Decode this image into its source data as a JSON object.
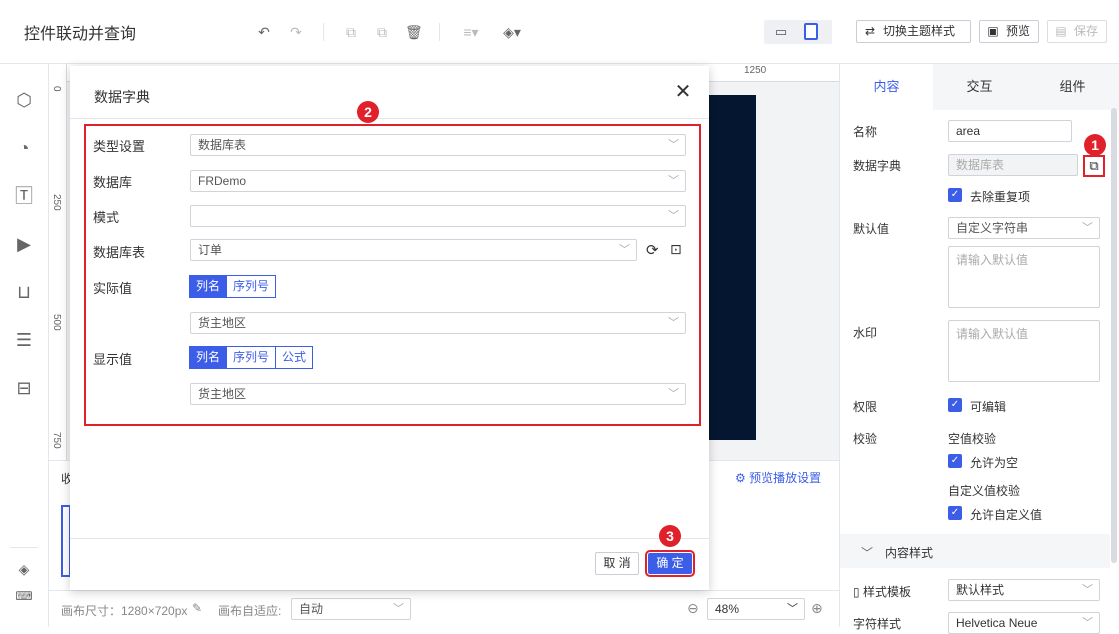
{
  "app": {
    "title": "控件联动并查询"
  },
  "toolbar": {
    "switch_theme": "切换主题样式",
    "preview": "预览",
    "save": "保存"
  },
  "ruler": {
    "top_mark": "1250",
    "left_marks": [
      "0",
      "250",
      "500",
      "750"
    ]
  },
  "canvas": {
    "collapse_label": "收",
    "preview_play_settings": "预览播放设置",
    "size_label": "画布尺寸：1280×720px",
    "adapt_label": "画布自适应:",
    "adapt_value": "自动",
    "zoom": "48%"
  },
  "dialog": {
    "title": "数据字典",
    "fields": {
      "type_label": "类型设置",
      "type_value": "数据库表",
      "db_label": "数据库",
      "db_value": "FRDemo",
      "schema_label": "模式",
      "schema_value": "",
      "table_label": "数据库表",
      "table_value": "订单",
      "actual_label": "实际值",
      "actual_tabs": [
        "列名",
        "序列号"
      ],
      "actual_value": "货主地区",
      "display_label": "显示值",
      "display_tabs": [
        "列名",
        "序列号",
        "公式"
      ],
      "display_value": "货主地区"
    },
    "cancel": "取 消",
    "ok": "确 定"
  },
  "badges": [
    "1",
    "2",
    "3"
  ],
  "right_panel": {
    "tabs": [
      "内容",
      "交互",
      "组件"
    ],
    "name_label": "名称",
    "name_value": "area",
    "dict_label": "数据字典",
    "dict_value": "数据库表",
    "dedupe": "去除重复项",
    "default_label": "默认值",
    "default_type": "自定义字符串",
    "default_placeholder": "请输入默认值",
    "watermark_label": "水印",
    "watermark_placeholder": "请输入默认值",
    "perm_label": "权限",
    "editable": "可编辑",
    "validate_label": "校验",
    "null_check": "空值校验",
    "allow_null": "允许为空",
    "custom_check": "自定义值校验",
    "allow_custom": "允许自定义值",
    "content_style": "内容样式",
    "style_template_label": "样式模板",
    "style_template_value": "默认样式",
    "font_style_label": "字符样式",
    "font_style_value": "Helvetica Neue"
  },
  "colors": {
    "accent": "#3c5de8",
    "highlight": "#e0202a",
    "canvas_dark": "#051630"
  }
}
